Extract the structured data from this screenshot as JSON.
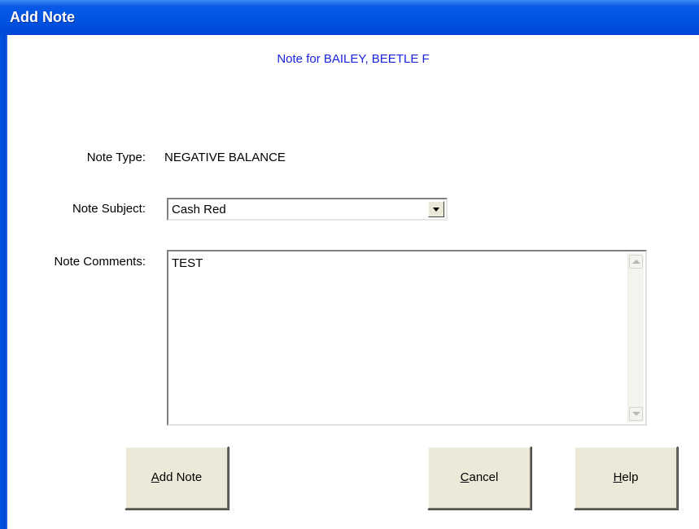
{
  "window": {
    "title": "Add Note"
  },
  "header": {
    "text": "Note for BAILEY, BEETLE F"
  },
  "form": {
    "note_type_label": "Note Type:",
    "note_type_value": "NEGATIVE BALANCE",
    "note_subject_label": "Note Subject:",
    "note_subject_value": "Cash Red",
    "note_comments_label": "Note Comments:",
    "note_comments_value": "TEST"
  },
  "buttons": {
    "add_note": {
      "mnemonic": "A",
      "rest": "dd Note"
    },
    "cancel": {
      "mnemonic": "C",
      "rest": "ancel"
    },
    "help": {
      "mnemonic": "H",
      "rest": "elp"
    }
  },
  "colors": {
    "titlebar": "#0054e3",
    "heading_text": "#1a24e0",
    "button_face": "#ece9d8"
  },
  "icons": {
    "combo_dropdown": "triangle-down",
    "scroll_up": "chevron-up",
    "scroll_down": "chevron-down"
  }
}
